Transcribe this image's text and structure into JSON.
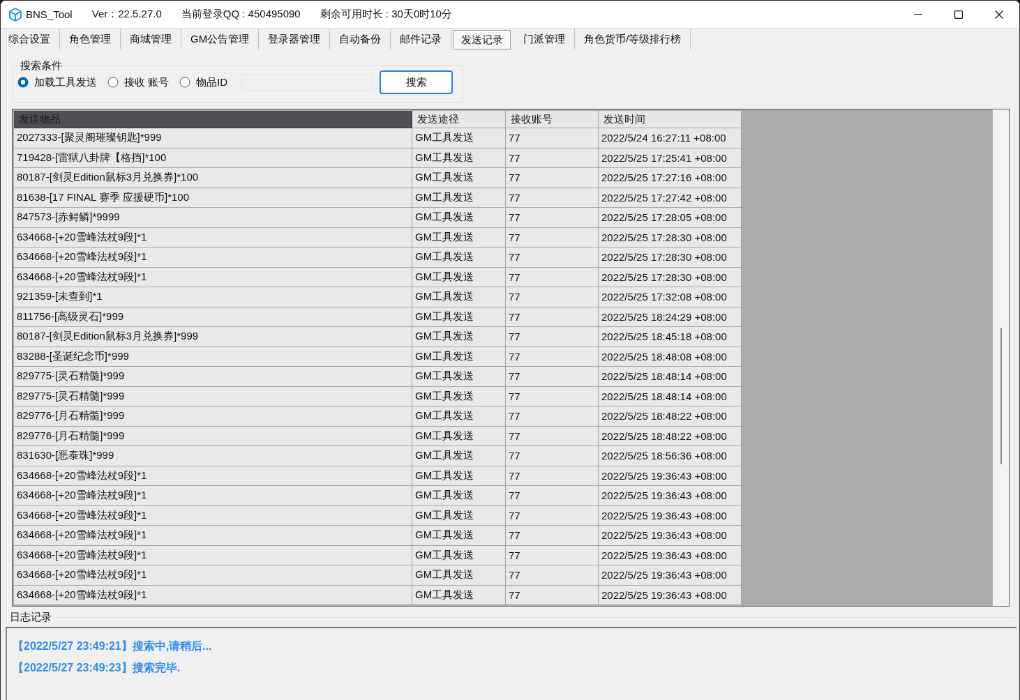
{
  "window": {
    "title": "BNS_Tool",
    "version": "Ver：22.5.27.0",
    "account": "当前登录QQ : 450495090",
    "remaining": "剩余可用时长 : 30天0时10分"
  },
  "tabs": [
    {
      "label": "综合设置",
      "selected": false
    },
    {
      "label": "角色管理",
      "selected": false
    },
    {
      "label": "商城管理",
      "selected": false
    },
    {
      "label": "GM公告管理",
      "selected": false
    },
    {
      "label": "登录器管理",
      "selected": false
    },
    {
      "label": "自动备份",
      "selected": false
    },
    {
      "label": "邮件记录",
      "selected": false
    },
    {
      "label": "发送记录",
      "selected": true
    },
    {
      "label": "门派管理",
      "selected": false
    },
    {
      "label": "角色货币/等级排行榜",
      "selected": false
    }
  ],
  "search": {
    "title": "搜索条件",
    "options": [
      {
        "label": "加载工具发送",
        "selected": true
      },
      {
        "label": "接收 账号",
        "selected": false
      },
      {
        "label": "物品ID",
        "selected": false
      }
    ],
    "field": {
      "disabled": true
    },
    "button": {
      "label": "搜索",
      "default": true
    }
  },
  "table": {
    "columns": [
      {
        "label": "发送物品",
        "selected": true
      },
      {
        "label": "发送途径",
        "selected": false
      },
      {
        "label": "接收账号",
        "selected": false
      },
      {
        "label": "发送时间",
        "selected": false
      }
    ],
    "rows": [
      [
        "2027333-[聚灵阁璀璨钥匙]*999",
        "GM工具发送",
        "77",
        "2022/5/24 16:27:11 +08:00"
      ],
      [
        "719428-[雷狱八卦牌【格挡]*100",
        "GM工具发送",
        "77",
        "2022/5/25 17:25:41 +08:00"
      ],
      [
        "80187-[剑灵Edition鼠标3月兑换券]*100",
        "GM工具发送",
        "77",
        "2022/5/25 17:27:16 +08:00"
      ],
      [
        "81638-[17 FINAL 赛季 应援硬币]*100",
        "GM工具发送",
        "77",
        "2022/5/25 17:27:42 +08:00"
      ],
      [
        "847573-[赤鲟鳞]*9999",
        "GM工具发送",
        "77",
        "2022/5/25 17:28:05 +08:00"
      ],
      [
        "634668-[+20雪峰法杖9段]*1",
        "GM工具发送",
        "77",
        "2022/5/25 17:28:30 +08:00"
      ],
      [
        "634668-[+20雪峰法杖9段]*1",
        "GM工具发送",
        "77",
        "2022/5/25 17:28:30 +08:00"
      ],
      [
        "634668-[+20雪峰法杖9段]*1",
        "GM工具发送",
        "77",
        "2022/5/25 17:28:30 +08:00"
      ],
      [
        "921359-[未查到]*1",
        "GM工具发送",
        "77",
        "2022/5/25 17:32:08 +08:00"
      ],
      [
        "811756-[高级灵石]*999",
        "GM工具发送",
        "77",
        "2022/5/25 18:24:29 +08:00"
      ],
      [
        "80187-[剑灵Edition鼠标3月兑换券]*999",
        "GM工具发送",
        "77",
        "2022/5/25 18:45:18 +08:00"
      ],
      [
        "83288-[圣诞纪念币]*999",
        "GM工具发送",
        "77",
        "2022/5/25 18:48:08 +08:00"
      ],
      [
        "829775-[灵石精髓]*999",
        "GM工具发送",
        "77",
        "2022/5/25 18:48:14 +08:00"
      ],
      [
        "829775-[灵石精髓]*999",
        "GM工具发送",
        "77",
        "2022/5/25 18:48:14 +08:00"
      ],
      [
        "829776-[月石精髓]*999",
        "GM工具发送",
        "77",
        "2022/5/25 18:48:22 +08:00"
      ],
      [
        "829776-[月石精髓]*999",
        "GM工具发送",
        "77",
        "2022/5/25 18:48:22 +08:00"
      ],
      [
        "831630-[恶泰珠]*999",
        "GM工具发送",
        "77",
        "2022/5/25 18:56:36 +08:00"
      ],
      [
        "634668-[+20雪峰法杖9段]*1",
        "GM工具发送",
        "77",
        "2022/5/25 19:36:43 +08:00"
      ],
      [
        "634668-[+20雪峰法杖9段]*1",
        "GM工具发送",
        "77",
        "2022/5/25 19:36:43 +08:00"
      ],
      [
        "634668-[+20雪峰法杖9段]*1",
        "GM工具发送",
        "77",
        "2022/5/25 19:36:43 +08:00"
      ],
      [
        "634668-[+20雪峰法杖9段]*1",
        "GM工具发送",
        "77",
        "2022/5/25 19:36:43 +08:00"
      ],
      [
        "634668-[+20雪峰法杖9段]*1",
        "GM工具发送",
        "77",
        "2022/5/25 19:36:43 +08:00"
      ],
      [
        "634668-[+20雪峰法杖9段]*1",
        "GM工具发送",
        "77",
        "2022/5/25 19:36:43 +08:00"
      ],
      [
        "634668-[+20雪峰法杖9段]*1",
        "GM工具发送",
        "77",
        "2022/5/25 19:36:43 +08:00"
      ]
    ]
  },
  "log": {
    "title": "日志记录",
    "entries": [
      "【2022/5/27 23:49:21】搜索中,请稍后...",
      "【2022/5/27 23:49:23】搜索完毕."
    ]
  }
}
